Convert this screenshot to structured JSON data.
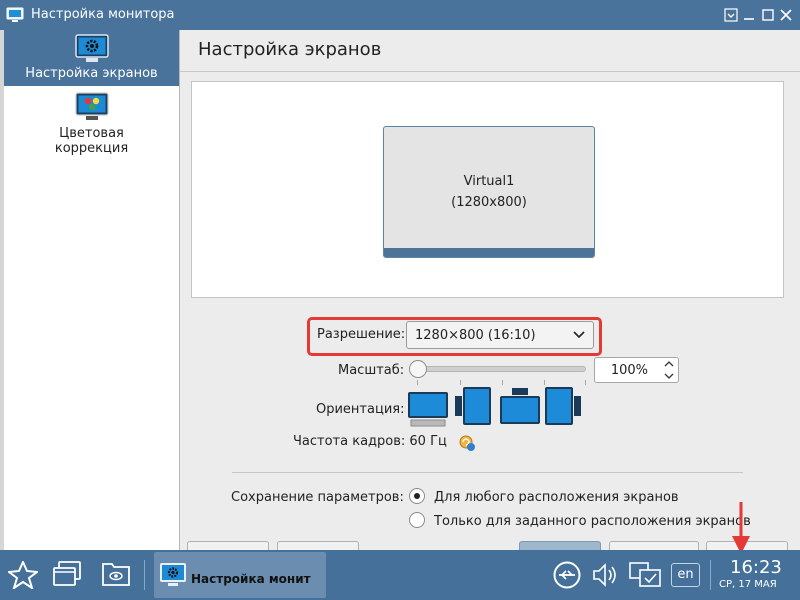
{
  "window": {
    "title": "Настройка монитора"
  },
  "sidebar": {
    "items": [
      {
        "label": "Настройка экранов",
        "icon": "monitor-gear-icon",
        "active": true
      },
      {
        "label_line1": "Цветовая",
        "label_line2": "коррекция",
        "icon": "color-correction-icon",
        "active": false
      }
    ]
  },
  "main": {
    "title": "Настройка экранов",
    "monitor": {
      "name": "Virtual1",
      "resolution": "(1280x800)"
    },
    "resolution": {
      "label": "Разрешение:",
      "value": "1280×800 (16:10)"
    },
    "scale": {
      "label": "Масштаб:",
      "value": "100%",
      "level_percent": 0
    },
    "orientation": {
      "label": "Ориентация:",
      "options": [
        "landscape-icon",
        "portrait-left-icon",
        "landscape-flipped-icon",
        "portrait-right-icon"
      ],
      "selected": 0
    },
    "refresh": {
      "label": "Частота кадров: 60 Гц"
    },
    "save": {
      "label": "Сохранение параметров:",
      "options": [
        {
          "label": "Для любого расположения экранов",
          "checked": true
        },
        {
          "label": "Только для заданного расположения экранов",
          "checked": false
        }
      ]
    }
  },
  "taskbar": {
    "active_app": "Настройка монит",
    "lang": "en",
    "time": "16:23",
    "date": "СР, 17 МАЯ"
  },
  "colors": {
    "accent": "#4a739b",
    "highlight": "#e53935"
  }
}
